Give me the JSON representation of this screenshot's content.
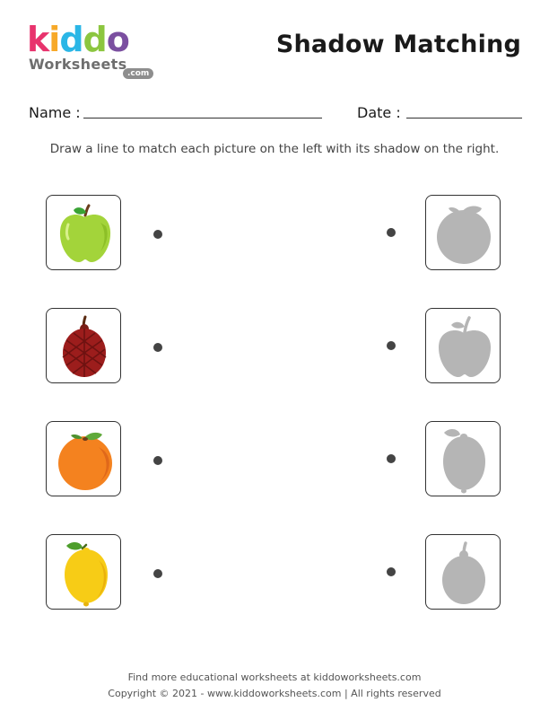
{
  "header": {
    "logo": {
      "kiddo": "kiddo",
      "worksheets": "Worksheets",
      "domain": ".com"
    },
    "title": "Shadow Matching"
  },
  "form": {
    "name_label": "Name :",
    "date_label": "Date :"
  },
  "instructions": "Draw a line to match each picture on the left with its shadow on the right.",
  "left_pictures": [
    {
      "icon": "green-apple-icon"
    },
    {
      "icon": "lychee-icon"
    },
    {
      "icon": "orange-icon"
    },
    {
      "icon": "lemon-icon"
    }
  ],
  "right_shadows": [
    {
      "icon": "orange-shadow-icon"
    },
    {
      "icon": "apple-shadow-icon"
    },
    {
      "icon": "lemon-shadow-icon"
    },
    {
      "icon": "lychee-shadow-icon"
    }
  ],
  "colors": {
    "shadow": "#b5b5b5",
    "card_border": "#333333",
    "logo_k": "#e8336d",
    "logo_i": "#f7a928",
    "logo_d1": "#2bb6e6",
    "logo_d2": "#8cc63f",
    "logo_o": "#7b4fa0"
  },
  "footer": {
    "line1": "Find more educational worksheets at kiddoworksheets.com",
    "line2": "Copyright © 2021 - www.kiddoworksheets.com  |  All rights reserved"
  }
}
